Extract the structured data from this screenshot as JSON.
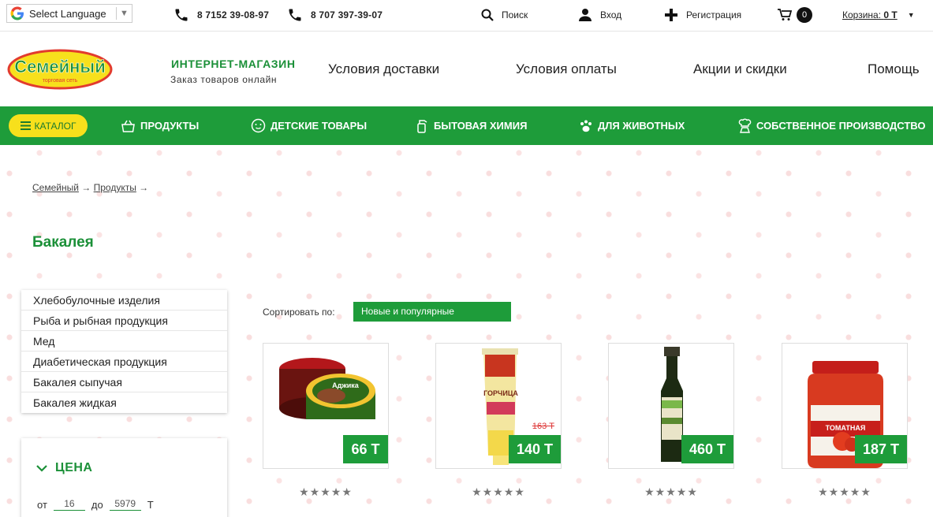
{
  "topbar": {
    "language_label": "Select Language",
    "language_arrow": "▼",
    "phone1": "8 7152 39-08-97",
    "phone2": "8 707 397-39-07",
    "search": "Поиск",
    "login": "Вход",
    "register": "Регистрация",
    "cart_count": "0",
    "cart_label": "Корзина:",
    "cart_total": "0 Т"
  },
  "header": {
    "logo_text": "Семейный",
    "logo_sub": "торговая сеть",
    "shop_title": "ИНТЕРНЕТ-МАГАЗИН",
    "shop_sub": "Заказ товаров онлайн",
    "nav": [
      "Условия доставки",
      "Условия оплаты",
      "Акции и скидки",
      "Помощь"
    ]
  },
  "menu": {
    "catalog": "КАТАЛОГ",
    "items": [
      "ПРОДУКТЫ",
      "ДЕТСКИЕ ТОВАРЫ",
      "БЫТОВАЯ ХИМИЯ",
      "ДЛЯ ЖИВОТНЫХ",
      "СОБСТВЕННОЕ ПРОИЗВОДСТВО"
    ]
  },
  "breadcrumb": {
    "home": "Семейный",
    "products": "Продукты",
    "sep": "→"
  },
  "page_title": "Бакалея",
  "categories": [
    "Хлебобулочные изделия",
    "Рыба и рыбная продукция",
    "Мед",
    "Диабетическая продукция",
    "Бакалея сыпучая",
    "Бакалея жидкая"
  ],
  "filter": {
    "title": "ЦЕНА",
    "from_label": "от",
    "from_value": "16",
    "to_label": "до",
    "to_value": "5979",
    "currency": "Т"
  },
  "sort": {
    "label": "Сортировать по:",
    "value": "Новые и популярные"
  },
  "products": [
    {
      "price": "66 Т",
      "old_price": "",
      "label": "Аджика",
      "rating": "★★★★★"
    },
    {
      "price": "140 Т",
      "old_price": "163 Т",
      "label": "ГОРЧИЦА",
      "rating": "★★★★★"
    },
    {
      "price": "460 Т",
      "old_price": "",
      "label": "",
      "rating": "★★★★★"
    },
    {
      "price": "187 Т",
      "old_price": "",
      "label": "ТОМАТНАЯ",
      "rating": "★★★★★"
    }
  ],
  "colors": {
    "brand_green": "#1e9c3a",
    "catalog_yellow": "#f7e01c",
    "old_price_red": "#dd3333"
  }
}
